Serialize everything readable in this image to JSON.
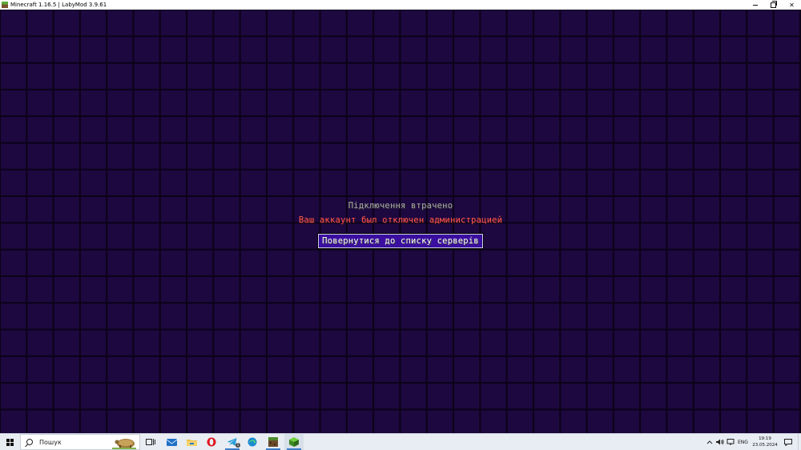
{
  "window": {
    "title": "Minecraft 1.16.5 | LabyMod 3.9.61",
    "controls": {
      "minimize": "minimize",
      "restore": "restore",
      "close": "✕"
    }
  },
  "screen": {
    "title": "Підключення втрачено",
    "reason": "Ваш аккаунт был отключен администрацией",
    "back_button_label": "Повернутися до списку серверів",
    "colors": {
      "background": "#1d0840",
      "grid": "#0b0216",
      "reason": "#ff5555",
      "button": "#3a0fa0"
    }
  },
  "taskbar": {
    "search_placeholder": "Пошук",
    "apps": [
      {
        "name": "task-view",
        "icon": "task-view-icon"
      },
      {
        "name": "mail",
        "icon": "mail-icon"
      },
      {
        "name": "file-explorer",
        "icon": "folder-icon"
      },
      {
        "name": "opera",
        "icon": "opera-icon"
      },
      {
        "name": "telegram",
        "icon": "telegram-icon",
        "badge": "1"
      },
      {
        "name": "edge",
        "icon": "edge-icon"
      },
      {
        "name": "minecraft-launcher",
        "icon": "minecraft-launcher-icon"
      },
      {
        "name": "minecraft",
        "icon": "minecraft-icon"
      }
    ],
    "tray": {
      "language": "ENG",
      "time": "19:19",
      "date": "23.05.2024"
    }
  }
}
